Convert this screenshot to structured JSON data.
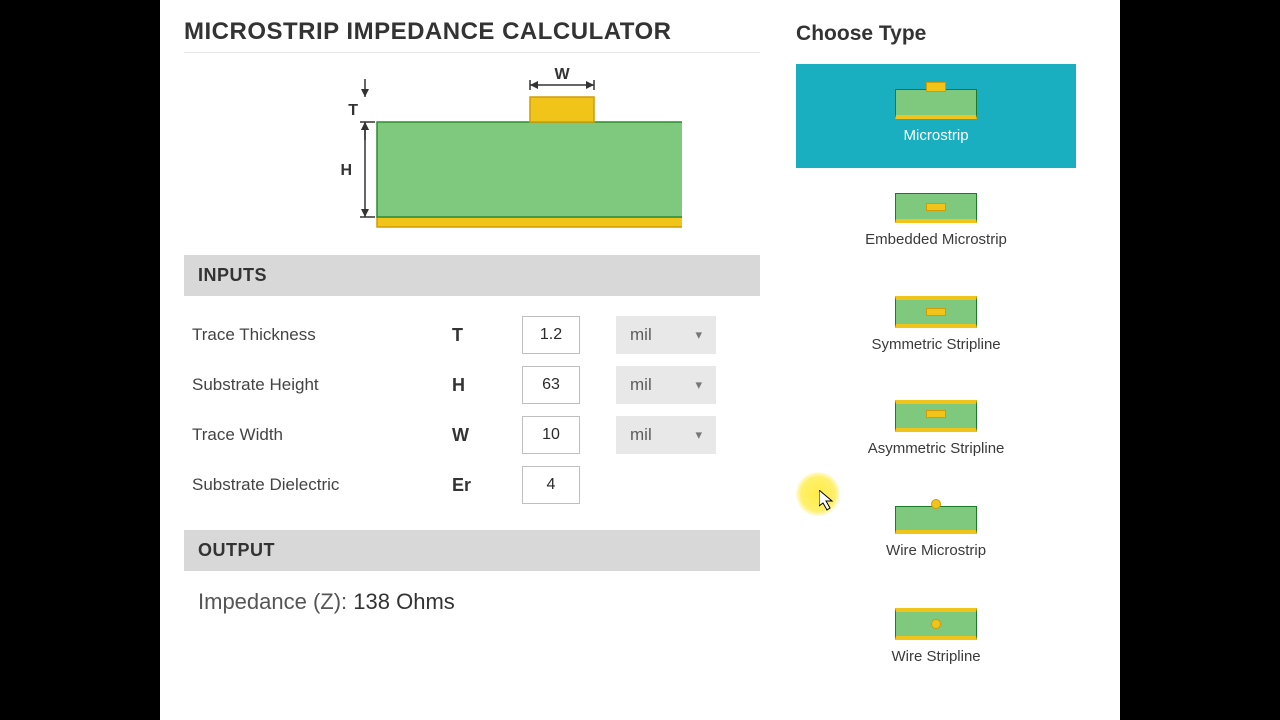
{
  "title": "MICROSTRIP IMPEDANCE CALCULATOR",
  "diagram": {
    "W": "W",
    "T": "T",
    "H": "H"
  },
  "sections": {
    "inputs": "INPUTS",
    "output": "OUTPUT"
  },
  "inputs": [
    {
      "label": "Trace Thickness",
      "symbol": "T",
      "value": "1.2",
      "unit": "mil",
      "has_unit": true
    },
    {
      "label": "Substrate Height",
      "symbol": "H",
      "value": "63",
      "unit": "mil",
      "has_unit": true
    },
    {
      "label": "Trace Width",
      "symbol": "W",
      "value": "10",
      "unit": "mil",
      "has_unit": true
    },
    {
      "label": "Substrate Dielectric",
      "symbol": "Er",
      "value": "4",
      "unit": "",
      "has_unit": false
    }
  ],
  "output": {
    "label": "Impedance (Z): ",
    "value": "138 Ohms"
  },
  "right": {
    "title": "Choose Type",
    "types": [
      {
        "label": "Microstrip",
        "selected": true,
        "thumb": "micro"
      },
      {
        "label": "Embedded Microstrip",
        "selected": false,
        "thumb": "embed"
      },
      {
        "label": "Symmetric Stripline",
        "selected": false,
        "thumb": "sym"
      },
      {
        "label": "Asymmetric Stripline",
        "selected": false,
        "thumb": "asym"
      },
      {
        "label": "Wire Microstrip",
        "selected": false,
        "thumb": "wiremicro"
      },
      {
        "label": "Wire Stripline",
        "selected": false,
        "thumb": "wirestrip"
      }
    ]
  }
}
